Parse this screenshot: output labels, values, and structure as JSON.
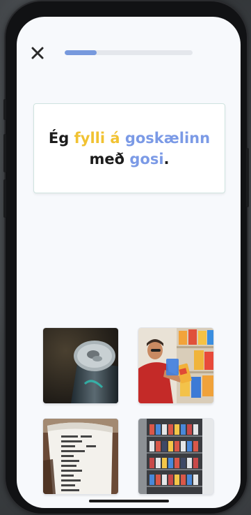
{
  "header": {
    "close_icon": "close-icon",
    "progress_fraction": 0.25
  },
  "sentence": {
    "parts": [
      {
        "text": "Ég ",
        "style": "plain"
      },
      {
        "text": "fylli á",
        "style": "highlight-yellow"
      },
      {
        "text": " ",
        "style": "plain"
      },
      {
        "text": "goskælinn",
        "style": "highlight-blue"
      },
      {
        "text": " með ",
        "style": "plain"
      },
      {
        "text": "gosi",
        "style": "highlight-blue"
      },
      {
        "text": ".",
        "style": "plain"
      }
    ]
  },
  "colors": {
    "highlight_yellow": "#f1c232",
    "highlight_blue": "#7b9ae6",
    "progress_fill": "#7799dd",
    "progress_track": "#e4e7ec"
  },
  "options": [
    {
      "image": "soda-can-photo"
    },
    {
      "image": "person-stocking-snack-shelf-photo"
    },
    {
      "image": "printed-receipt-photo"
    },
    {
      "image": "drinks-fridge-photo"
    }
  ]
}
